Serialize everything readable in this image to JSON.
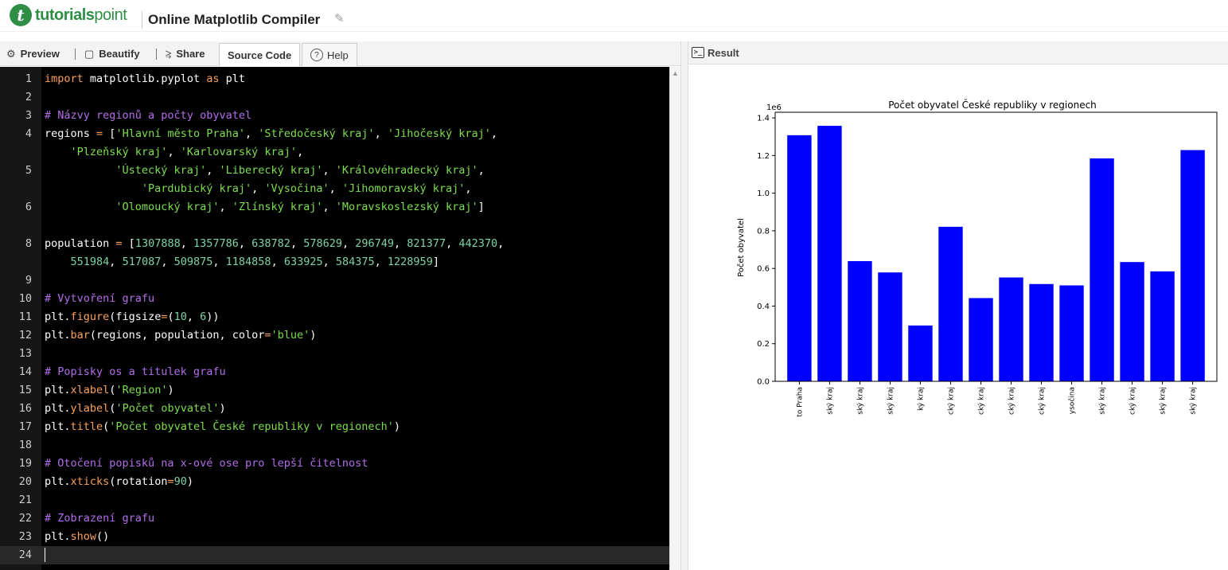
{
  "header": {
    "logo_text_bold": "tutorials",
    "logo_text_rest": "point",
    "logo_mark": "t",
    "title": "Online Matplotlib Compiler",
    "edit_icon": "pencil-icon"
  },
  "toolbar": {
    "preview": "Preview",
    "beautify": "Beautify",
    "share": "Share",
    "source_code": "Source Code",
    "help": "Help",
    "help_glyph": "?"
  },
  "result_panel": {
    "label": "Result",
    "icon_glyph": ">_"
  },
  "editor": {
    "line_numbers": [
      "1",
      "2",
      "3",
      "4",
      "",
      "5",
      "",
      "6",
      "",
      "8",
      "",
      "9",
      "10",
      "11",
      "12",
      "13",
      "14",
      "15",
      "16",
      "17",
      "18",
      "19",
      "20",
      "21",
      "22",
      "23",
      "24"
    ]
  },
  "chart_data": {
    "type": "bar",
    "title": "Počet obyvatel České republiky v regionech",
    "ylabel": "Počet obyvatel",
    "xlabel": "",
    "offset_label": "1e6",
    "ylim": [
      0,
      1.43
    ],
    "yticks": [
      "0.0",
      "0.2",
      "0.4",
      "0.6",
      "0.8",
      "1.0",
      "1.2",
      "1.4"
    ],
    "categories": [
      "to Praha",
      "ský kraj",
      "ský kraj",
      "ský kraj",
      "ký kraj",
      "cký kraj",
      "cký kraj",
      "cký kraj",
      "cký kraj",
      "ysočina",
      "ský kraj",
      "cký kraj",
      "ský kraj",
      "ský kraj"
    ],
    "values": [
      1307888,
      1357786,
      638782,
      578629,
      296749,
      821377,
      442370,
      551984,
      517087,
      509875,
      1184858,
      633925,
      584375,
      1228959
    ],
    "color": "#0000ff"
  }
}
